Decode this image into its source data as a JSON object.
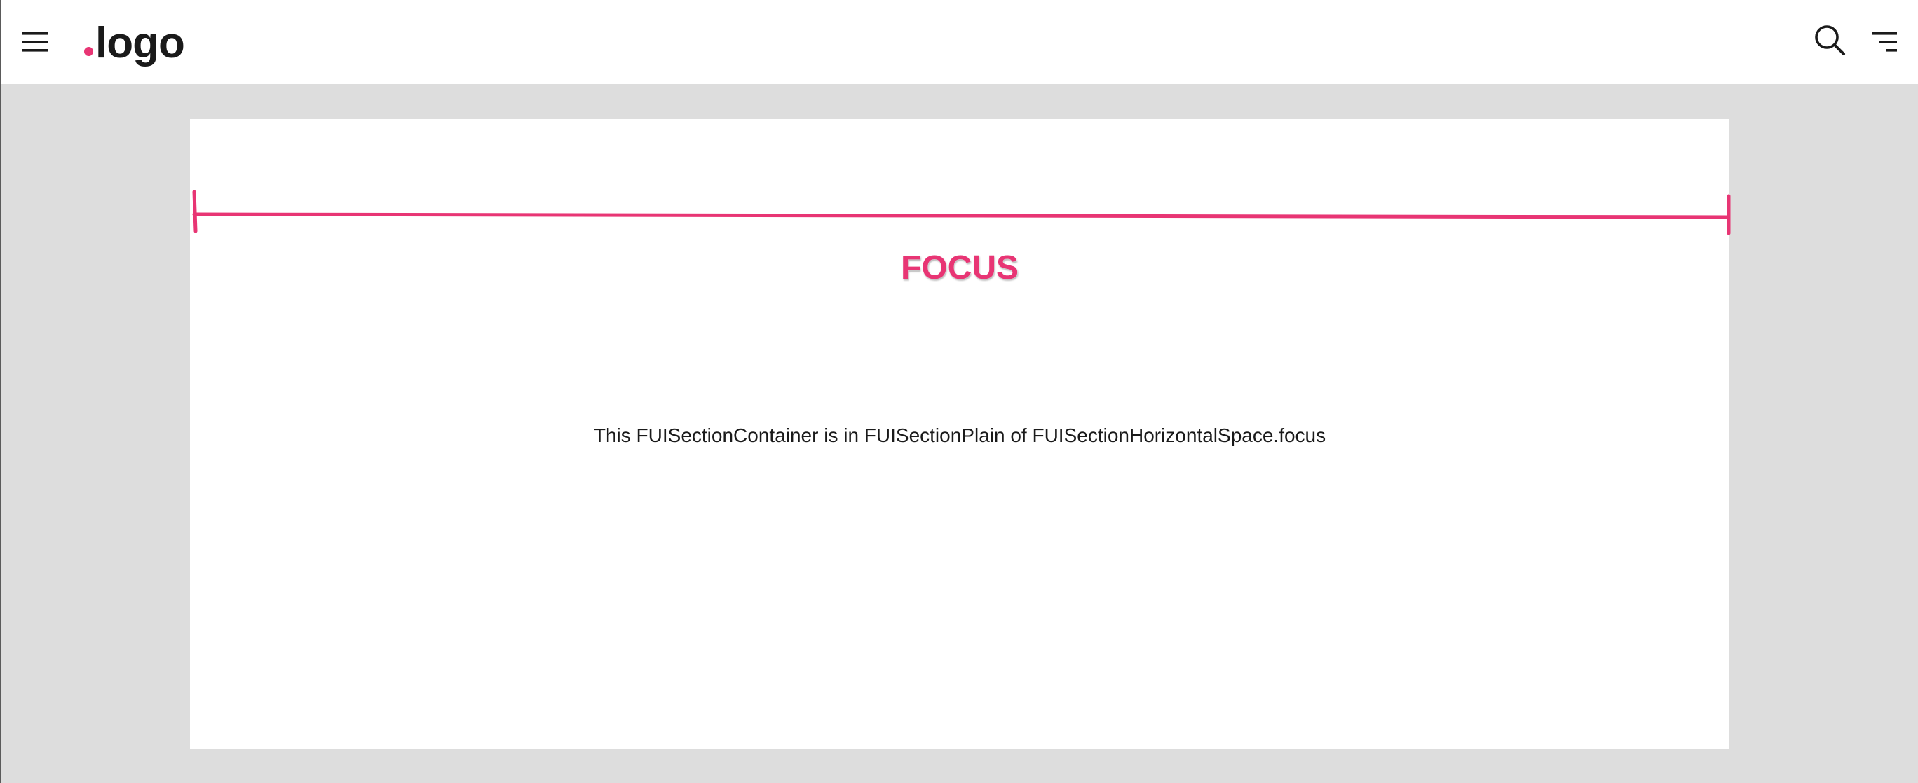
{
  "colors": {
    "accent": "#e83574",
    "text": "#1a1a1a",
    "page_background": "#dddddd",
    "surface": "#ffffff"
  },
  "header": {
    "logo_text": "logo",
    "logo_prefix": ".",
    "icons": {
      "menu": "hamburger-menu-icon",
      "search": "search-icon",
      "filter": "filter-list-icon"
    }
  },
  "section": {
    "focus_label": "FOCUS",
    "caption": "This FUISectionContainer is in FUISectionPlain of FUISectionHorizontalSpace.focus"
  }
}
